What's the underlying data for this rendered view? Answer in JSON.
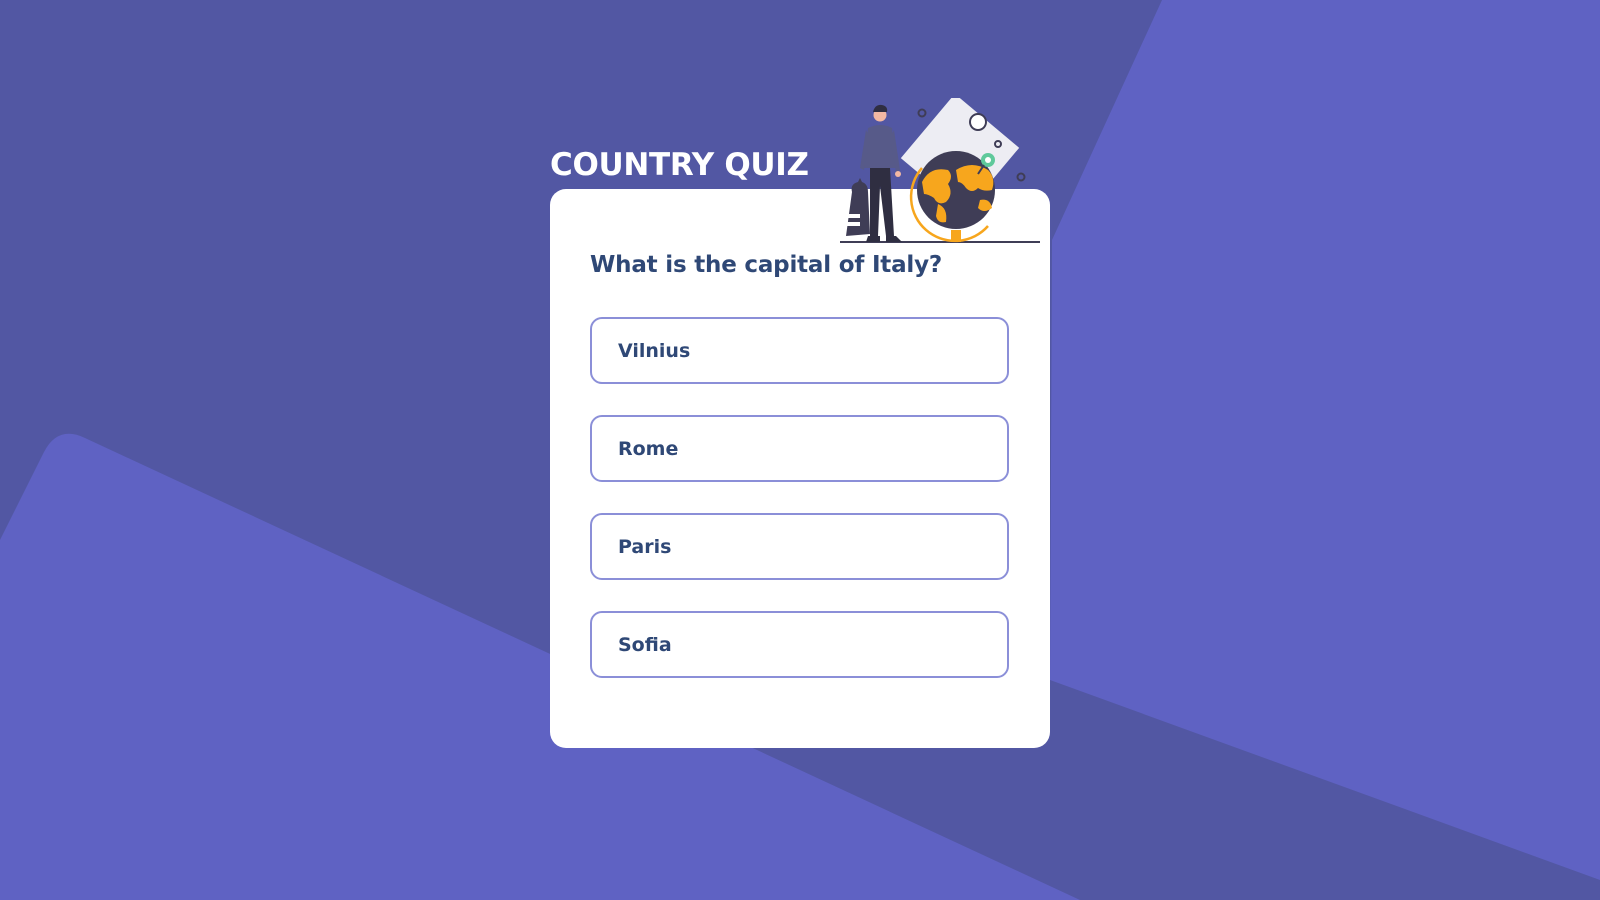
{
  "app": {
    "title": "COUNTRY QUIZ"
  },
  "question": {
    "text": "What is the capital of Italy?"
  },
  "options": [
    {
      "label": "Vilnius"
    },
    {
      "label": "Rome"
    },
    {
      "label": "Paris"
    },
    {
      "label": "Sofia"
    }
  ],
  "colors": {
    "background": "#5f62c3",
    "background_shape": "#5257a3",
    "card": "#ffffff",
    "text_dark": "#2f4876",
    "option_border": "#8b8fd8",
    "globe_accent": "#f7a61d",
    "pin_green": "#5fc99b"
  },
  "icons": {
    "illustration": "traveler-with-globe-illustration"
  }
}
